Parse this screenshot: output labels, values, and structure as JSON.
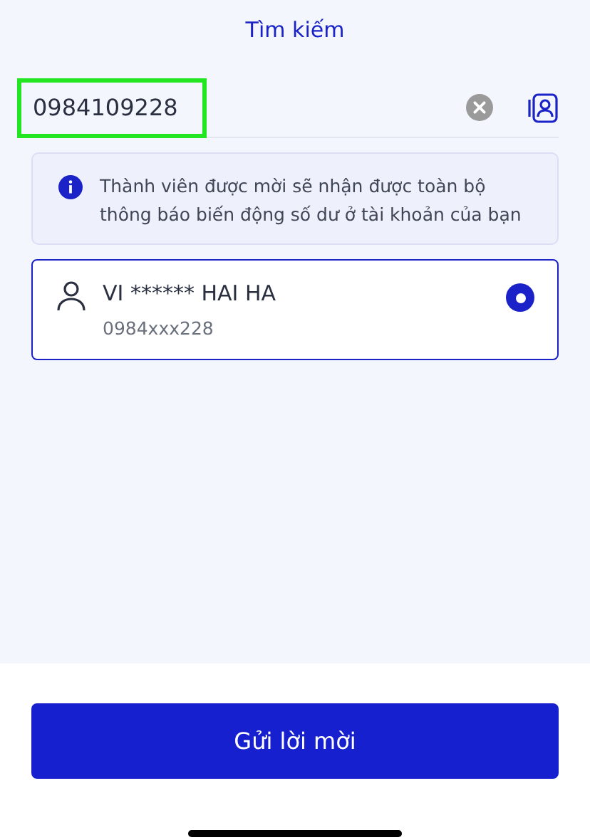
{
  "header": {
    "title": "Tìm kiếm"
  },
  "search": {
    "value": "0984109228"
  },
  "info": {
    "text": "Thành viên được mời sẽ nhận được toàn bộ thông báo biến động số dư ở tài khoản của bạn"
  },
  "results": [
    {
      "name": "VI ****** HAI HA",
      "phone": "0984xxx228",
      "selected": true
    }
  ],
  "primary_button": {
    "label": "Gửi lời mời"
  }
}
